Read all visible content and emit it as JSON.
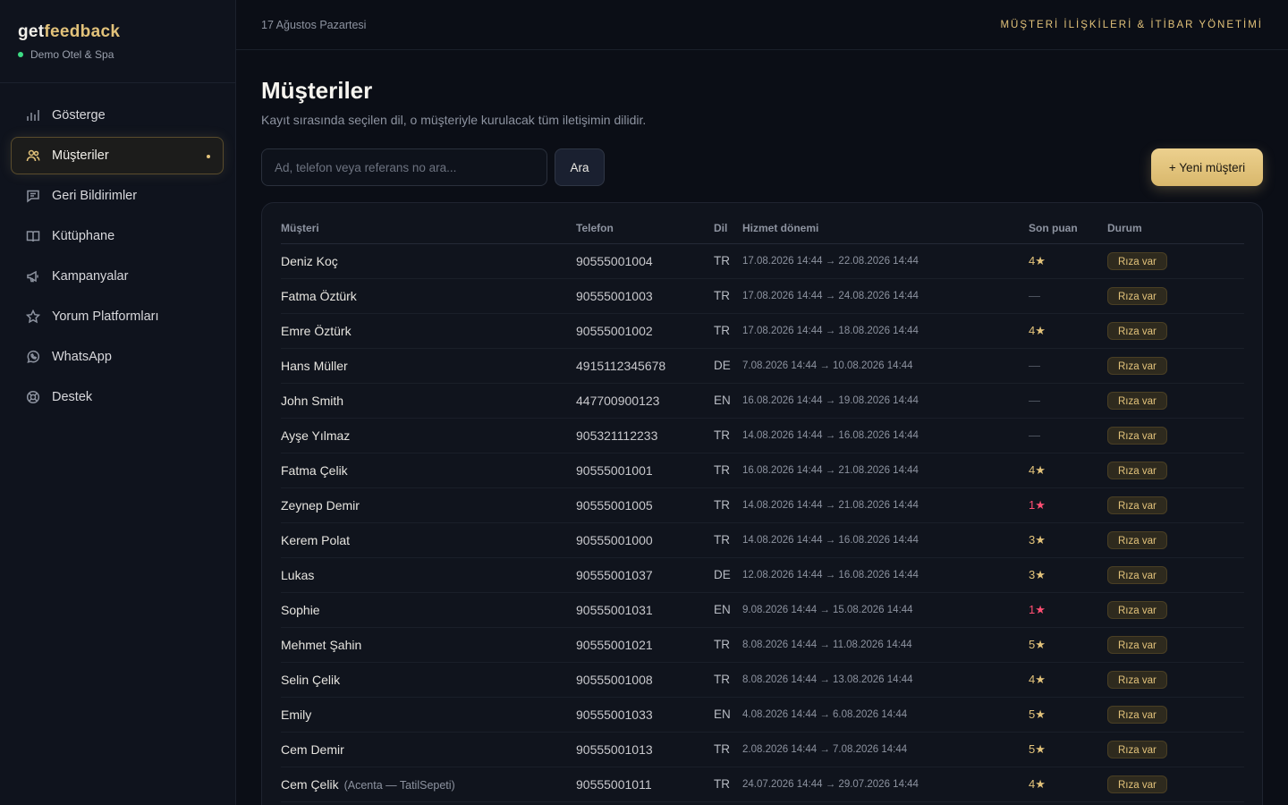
{
  "brand": {
    "logo_get": "get",
    "logo_feedback": "feedback",
    "hotel": "Demo Otel & Spa"
  },
  "sidebar": {
    "items": [
      {
        "label": "Gösterge",
        "icon": "bar-chart-icon",
        "active": false
      },
      {
        "label": "Müşteriler",
        "icon": "users-icon",
        "active": true
      },
      {
        "label": "Geri Bildirimler",
        "icon": "message-icon",
        "active": false
      },
      {
        "label": "Kütüphane",
        "icon": "book-icon",
        "active": false
      },
      {
        "label": "Kampanyalar",
        "icon": "megaphone-icon",
        "active": false
      },
      {
        "label": "Yorum Platformları",
        "icon": "star-icon",
        "active": false
      },
      {
        "label": "WhatsApp",
        "icon": "whatsapp-icon",
        "active": false
      },
      {
        "label": "Destek",
        "icon": "lifebuoy-icon",
        "active": false
      }
    ]
  },
  "topbar": {
    "date": "17 Ağustos Pazartesi",
    "tagline": "MÜŞTERİ İLİŞKİLERİ & İTİBAR YÖNETİMİ"
  },
  "main": {
    "title": "Müşteriler",
    "subtitle": "Kayıt sırasında seçilen dil, o müşteriyle kurulacak tüm iletişimin dilidir.",
    "search": {
      "placeholder": "Ad, telefon veya referans no ara...",
      "button": "Ara"
    },
    "new_button": "+ Yeni müşteri"
  },
  "table": {
    "headers": [
      "Müşteri",
      "Telefon",
      "Dil",
      "Hizmet dönemi",
      "Son puan",
      "Durum"
    ],
    "rows": [
      {
        "name": "Deniz Koç",
        "note": "",
        "phone": "90555001004",
        "lang": "TR",
        "period": "17.08.2026 14:44 → 22.08.2026 14:44",
        "score": "4★",
        "score_type": "gold",
        "status": "Rıza var"
      },
      {
        "name": "Fatma Öztürk",
        "note": "",
        "phone": "90555001003",
        "lang": "TR",
        "period": "17.08.2026 14:44 → 24.08.2026 14:44",
        "score": "—",
        "score_type": "dash",
        "status": "Rıza var"
      },
      {
        "name": "Emre Öztürk",
        "note": "",
        "phone": "90555001002",
        "lang": "TR",
        "period": "17.08.2026 14:44 → 18.08.2026 14:44",
        "score": "4★",
        "score_type": "gold",
        "status": "Rıza var"
      },
      {
        "name": "Hans Müller",
        "note": "",
        "phone": "4915112345678",
        "lang": "DE",
        "period": "7.08.2026 14:44 → 10.08.2026 14:44",
        "score": "—",
        "score_type": "dash",
        "status": "Rıza var"
      },
      {
        "name": "John Smith",
        "note": "",
        "phone": "447700900123",
        "lang": "EN",
        "period": "16.08.2026 14:44 → 19.08.2026 14:44",
        "score": "—",
        "score_type": "dash",
        "status": "Rıza var"
      },
      {
        "name": "Ayşe Yılmaz",
        "note": "",
        "phone": "905321112233",
        "lang": "TR",
        "period": "14.08.2026 14:44 → 16.08.2026 14:44",
        "score": "—",
        "score_type": "dash",
        "status": "Rıza var"
      },
      {
        "name": "Fatma Çelik",
        "note": "",
        "phone": "90555001001",
        "lang": "TR",
        "period": "16.08.2026 14:44 → 21.08.2026 14:44",
        "score": "4★",
        "score_type": "gold",
        "status": "Rıza var"
      },
      {
        "name": "Zeynep Demir",
        "note": "",
        "phone": "90555001005",
        "lang": "TR",
        "period": "14.08.2026 14:44 → 21.08.2026 14:44",
        "score": "1★",
        "score_type": "red",
        "status": "Rıza var"
      },
      {
        "name": "Kerem Polat",
        "note": "",
        "phone": "90555001000",
        "lang": "TR",
        "period": "14.08.2026 14:44 → 16.08.2026 14:44",
        "score": "3★",
        "score_type": "gold",
        "status": "Rıza var"
      },
      {
        "name": "Lukas",
        "note": "",
        "phone": "90555001037",
        "lang": "DE",
        "period": "12.08.2026 14:44 → 16.08.2026 14:44",
        "score": "3★",
        "score_type": "gold",
        "status": "Rıza var"
      },
      {
        "name": "Sophie",
        "note": "",
        "phone": "90555001031",
        "lang": "EN",
        "period": "9.08.2026 14:44 → 15.08.2026 14:44",
        "score": "1★",
        "score_type": "red",
        "status": "Rıza var"
      },
      {
        "name": "Mehmet Şahin",
        "note": "",
        "phone": "90555001021",
        "lang": "TR",
        "period": "8.08.2026 14:44 → 11.08.2026 14:44",
        "score": "5★",
        "score_type": "gold",
        "status": "Rıza var"
      },
      {
        "name": "Selin Çelik",
        "note": "",
        "phone": "90555001008",
        "lang": "TR",
        "period": "8.08.2026 14:44 → 13.08.2026 14:44",
        "score": "4★",
        "score_type": "gold",
        "status": "Rıza var"
      },
      {
        "name": "Emily",
        "note": "",
        "phone": "90555001033",
        "lang": "EN",
        "period": "4.08.2026 14:44 → 6.08.2026 14:44",
        "score": "5★",
        "score_type": "gold",
        "status": "Rıza var"
      },
      {
        "name": "Cem Demir",
        "note": "",
        "phone": "90555001013",
        "lang": "TR",
        "period": "2.08.2026 14:44 → 7.08.2026 14:44",
        "score": "5★",
        "score_type": "gold",
        "status": "Rıza var"
      },
      {
        "name": "Cem Çelik",
        "note": "(Acenta — TatilSepeti)",
        "phone": "90555001011",
        "lang": "TR",
        "period": "24.07.2026 14:44 → 29.07.2026 14:44",
        "score": "4★",
        "score_type": "gold",
        "status": "Rıza var"
      }
    ]
  },
  "colors": {
    "accent": "#e2c27a",
    "background": "#0b0e16",
    "sidebar": "#0f131d",
    "online": "#3ddc84",
    "low_score": "#ff4f73"
  }
}
